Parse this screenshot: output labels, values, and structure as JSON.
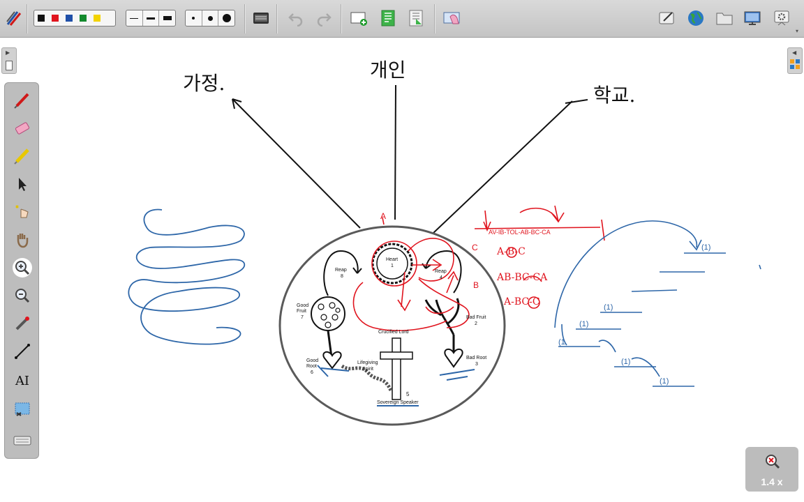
{
  "toolbar": {
    "pen_colors": [
      {
        "name": "black",
        "hex": "#111111"
      },
      {
        "name": "red",
        "hex": "#e0141e"
      },
      {
        "name": "blue",
        "hex": "#1f4fa8"
      },
      {
        "name": "green",
        "hex": "#138a2d"
      },
      {
        "name": "yellow",
        "hex": "#f2d300"
      }
    ],
    "line_widths": [
      "thin",
      "medium",
      "thick"
    ],
    "dot_sizes": [
      "small",
      "medium",
      "large"
    ],
    "icons_left": [
      "pen-set-icon",
      "keyboard-icon",
      "undo-icon",
      "redo-icon",
      "new-page-icon",
      "previous-page-icon",
      "next-page-icon",
      "screen-capture-icon"
    ],
    "icons_right": [
      "tablet-icon",
      "globe-icon",
      "folder-icon",
      "display-icon",
      "settings-icon"
    ]
  },
  "left_tools": [
    "pen-icon",
    "eraser-icon",
    "highlighter-icon",
    "select-arrow-icon",
    "magic-pointer-icon",
    "pan-hand-icon",
    "zoom-in-icon",
    "zoom-out-icon",
    "laser-pointer-icon",
    "line-tool-icon",
    "text-tool-icon",
    "screen-clip-icon",
    "keyboard-icon"
  ],
  "text_tool_label": "AI",
  "zoom": {
    "level": "1.4 x"
  },
  "canvas": {
    "handwriting": [
      "가정.",
      "개인",
      "학교."
    ],
    "diagram_labels": {
      "heart": "Heart",
      "heart_num": "1",
      "reap_left": "Reap",
      "reap_left_num": "8",
      "reap_right": "Reap",
      "reap_right_num": "4",
      "good_fruit": "Good",
      "good_fruit_2": "Fruit",
      "good_fruit_num": "7",
      "bad_fruit": "Bad Fruit",
      "bad_fruit_num": "2",
      "crucified": "Crucified Lord",
      "good_root": "Good",
      "good_root_2": "Root",
      "good_root_num": "6",
      "bad_root": "Bad Root",
      "bad_root_num": "3",
      "lifegiving": "Lifegiving",
      "spirit": "Spirit",
      "sovereign": "Sovereign Speaker",
      "sovereign_num": "5"
    },
    "red_notes": [
      "A-B-C",
      "AB-BC-CA",
      "A-BC-C",
      "A",
      "B",
      "C"
    ],
    "colors": {
      "ink_black": "#111111",
      "ink_red": "#e0141e",
      "ink_blue": "#2d66a8"
    }
  }
}
